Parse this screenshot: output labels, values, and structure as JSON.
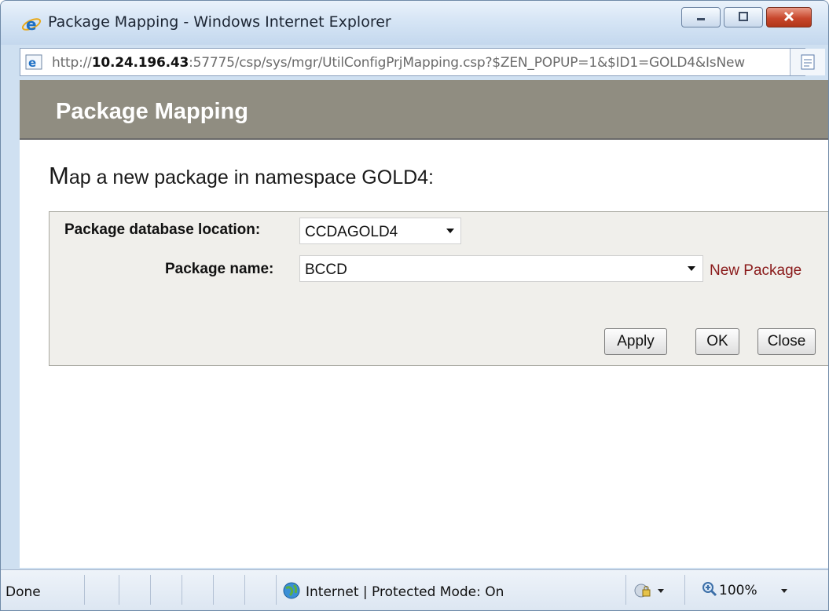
{
  "window": {
    "title": "Package Mapping - Windows Internet Explorer",
    "controls": {
      "minimize": "minimize",
      "maximize": "maximize",
      "close": "close"
    }
  },
  "address_bar": {
    "url_prefix": "http://",
    "url_host": "10.24.196.43",
    "url_rest": ":57775/csp/sys/mgr/UtilConfigPrjMapping.csp?$ZEN_POPUP=1&$ID1=GOLD4&IsNew"
  },
  "page": {
    "heading": "Package Mapping",
    "intro_first_letter": "M",
    "intro_rest": "ap a new package in namespace GOLD4:"
  },
  "form": {
    "database_label": "Package database location:",
    "database_value": "CCDAGOLD4",
    "package_label": "Package name:",
    "package_value": "BCCD",
    "new_package_link": "New Package",
    "apply_label": "Apply",
    "ok_label": "OK",
    "close_label": "Close"
  },
  "status_bar": {
    "status_text": "Done",
    "zone_text": "Internet | Protected Mode: On",
    "zoom_text": "100%"
  },
  "colors": {
    "header_band": "#908d81",
    "form_background": "#f0efeb",
    "link": "#8a1a1a",
    "window_chrome": "#cfe0f1"
  },
  "icons": [
    "internet-explorer-icon",
    "page-icon",
    "compatibility-view-icon",
    "globe-icon",
    "security-icon",
    "zoom-icon"
  ]
}
